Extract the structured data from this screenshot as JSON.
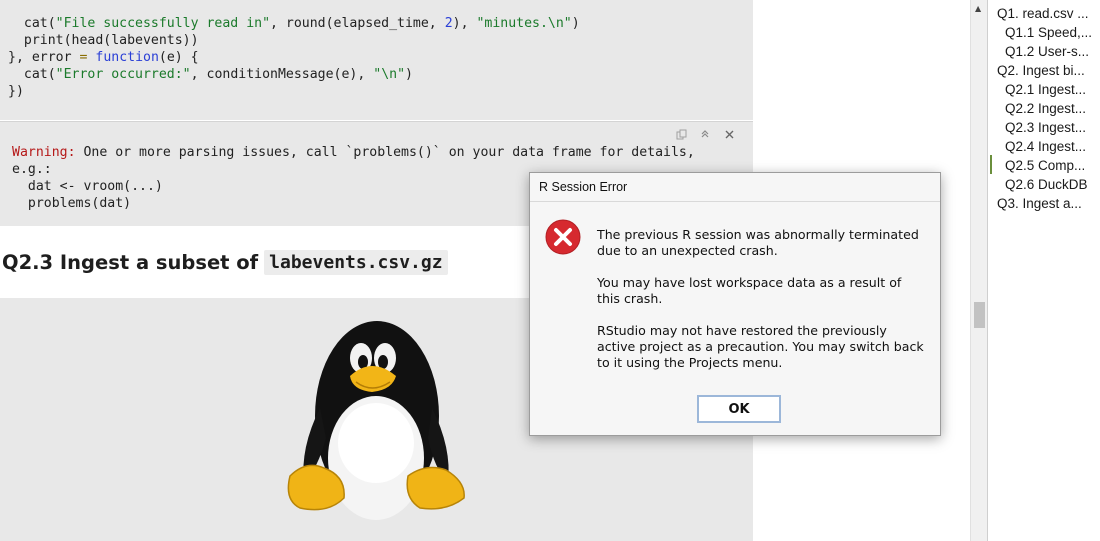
{
  "code": {
    "lines": [
      "  cat(\"File successfully read in\", round(elapsed_time, 2), \"minutes.\\n\")",
      "  print(head(labevents))",
      "}, error = function(e) {",
      "  cat(\"Error occurred:\", conditionMessage(e), \"\\n\")",
      "})"
    ]
  },
  "warning": {
    "label": "Warning:",
    "message": " One or more parsing issues, call `problems()` on your data frame for details,",
    "lines": [
      "e.g.:",
      "  dat <- vroom(...)",
      "  problems(dat)"
    ]
  },
  "section": {
    "title": "Q2.3 Ingest a subset of",
    "code": "labevents.csv.gz"
  },
  "outline": {
    "items": [
      "Q1. read.csv ...",
      "Q1.1 Speed,...",
      "Q1.2 User-s...",
      "Q2. Ingest bi...",
      "Q2.1 Ingest...",
      "Q2.2 Ingest...",
      "Q2.3 Ingest...",
      "Q2.4 Ingest...",
      "Q2.5 Comp...",
      "Q2.6 DuckDB",
      "Q3. Ingest a..."
    ]
  },
  "dialog": {
    "title": "R Session Error",
    "paragraphs": [
      "The previous R session was abnormally terminated due to an unexpected crash.",
      "You may have lost workspace data as a result of this crash.",
      "RStudio may not have restored the previously active project as a precaution. You may switch back to it using the Projects menu."
    ],
    "ok_label": "OK",
    "icon": "error-icon"
  },
  "colors": {
    "chunk_bg": "#e8e8e8",
    "string": "#1b7a2b",
    "keyword": "#2a3fd6",
    "warning_label": "#b51818",
    "error_icon": "#d6292f",
    "outline_active": "#6a8f3c"
  }
}
